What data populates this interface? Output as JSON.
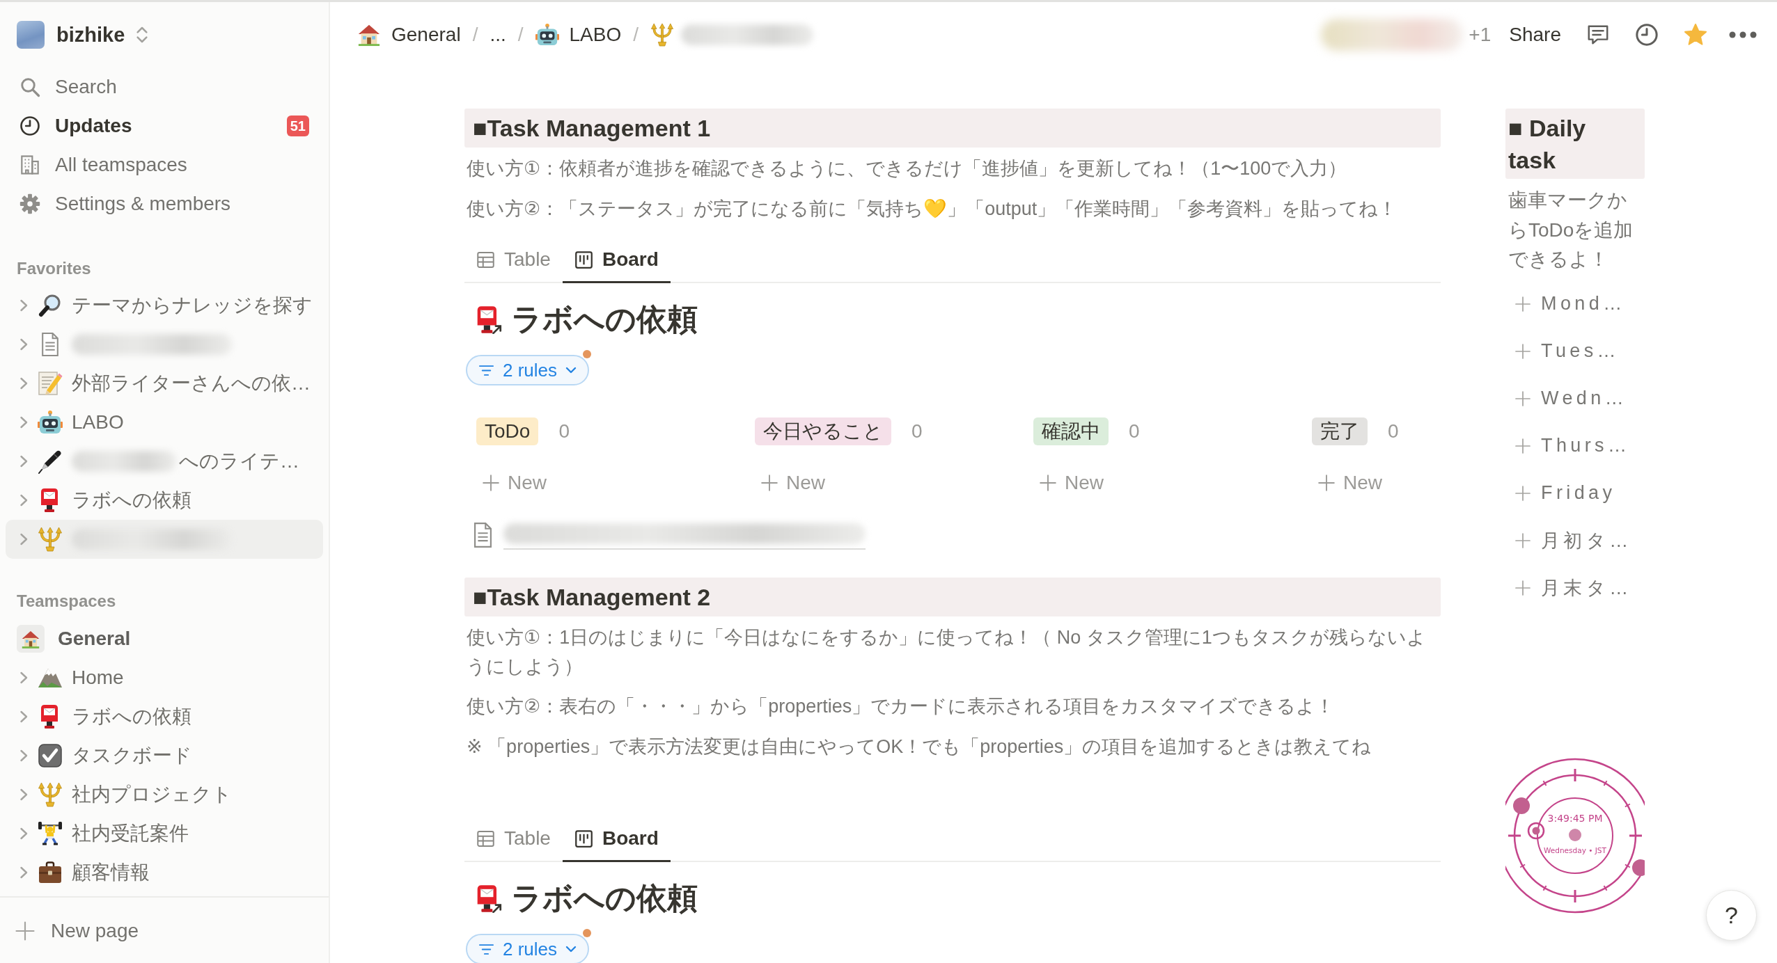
{
  "workspace": {
    "name": "bizhike"
  },
  "nav": [
    {
      "label": "Search",
      "unread": false
    },
    {
      "label": "Updates",
      "unread": true,
      "badge": "51"
    },
    {
      "label": "All teamspaces",
      "unread": false
    },
    {
      "label": "Settings & members",
      "unread": false
    }
  ],
  "favorites": {
    "heading": "Favorites",
    "items": [
      {
        "label": "テーマからナレッジを探す",
        "expanded": false,
        "selected": false
      },
      {
        "blurred": true,
        "expanded": false,
        "selected": false
      },
      {
        "label": "外部ライターさんへの依…",
        "expanded": false,
        "selected": false
      },
      {
        "label": "LABO",
        "expanded": false,
        "selected": false
      },
      {
        "label": "へのライテ…",
        "blurred": true,
        "expanded": false,
        "selected": false
      },
      {
        "label": "ラボへの依頼",
        "expanded": false,
        "selected": false
      },
      {
        "blurred": true,
        "expanded": false,
        "selected": true
      }
    ]
  },
  "teamspaces": {
    "heading": "Teamspaces",
    "team": "General",
    "items": [
      {
        "label": "Home",
        "expanded": false,
        "selected": false
      },
      {
        "label": "ラボへの依頼",
        "expanded": false,
        "selected": false
      },
      {
        "label": "タスクボード",
        "expanded": false,
        "selected": false
      },
      {
        "label": "社内プロジェクト",
        "expanded": false,
        "selected": false
      },
      {
        "label": "社内受託案件",
        "expanded": false,
        "selected": false
      },
      {
        "label": "顧客情報",
        "expanded": false,
        "selected": false
      }
    ]
  },
  "new_page": "New page",
  "breadcrumb": [
    {
      "label": "General"
    },
    {
      "label": "...",
      "separator": "/"
    },
    {
      "label": "LABO",
      "separator": "/"
    },
    {
      "separator": "/",
      "blurred": true
    }
  ],
  "topbar": {
    "avatars_blurred": true,
    "extra_count": "+1",
    "share": "Share",
    "favorited": true
  },
  "sections": [
    {
      "heading": "■Task Management 1",
      "notes": [
        "使い方①：依頼者が進捗を確認できるように、できるだけ「進捗値」を更新してね！（1〜100で入力）",
        "使い方②：「ステータス」が完了になる前に「気持ち💛」「output」「作業時間」「参考資料」を貼ってね！"
      ],
      "tabs": [
        {
          "label": "Table",
          "selected": false
        },
        {
          "label": "Board",
          "selected": true
        }
      ],
      "database_title": "ラボへの依頼",
      "filter": {
        "label": "2 rules",
        "modified": true
      },
      "groups": [
        {
          "name": "ToDo",
          "color": "#fdecc8",
          "count": "0",
          "new": "New"
        },
        {
          "name": "今日やること",
          "color": "#f5e0e9",
          "count": "0",
          "new": "New"
        },
        {
          "name": "確認中",
          "color": "#dbeddb",
          "count": "0",
          "new": "New"
        },
        {
          "name": "完了",
          "color": "#e3e2e0",
          "count": "0",
          "new": "New"
        }
      ],
      "page_link": {
        "blurred": true
      }
    },
    {
      "heading": "■Task Management 2",
      "notes": [
        "使い方①：1日のはじまりに「今日はなにをするか」に使ってね！（ No タスク管理に1つもタスクが残らないようにしよう）",
        "使い方②：表右の「・・・」から「properties」でカードに表示される項目をカスタマイズできるよ！",
        "※ 「properties」で表示方法変更は自由にやってOK！でも「properties」の項目を追加するときは教えてね"
      ],
      "tabs": [
        {
          "label": "Table",
          "selected": false
        },
        {
          "label": "Board",
          "selected": true
        }
      ],
      "database_title": "ラボへの依頼",
      "filter": {
        "label": "2 rules",
        "modified": true
      }
    }
  ],
  "daily": {
    "heading": "■ Daily task",
    "note": "歯車マークからToDoを追加できるよ！",
    "buttons": [
      "Mond…",
      "Tues…",
      "Wedn…",
      "Thurs…",
      "Friday",
      "月初タ…",
      "月末タ…"
    ]
  },
  "clock": {
    "time": "3:49:45 PM",
    "date": "Wednesday • JST"
  },
  "help": "?"
}
